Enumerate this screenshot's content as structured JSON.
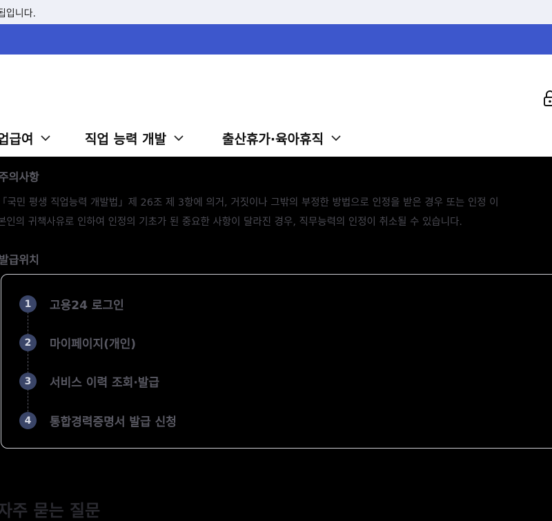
{
  "notice_bar": {
    "text": "됩입니다."
  },
  "header": {
    "nav": [
      {
        "label": "업급여"
      },
      {
        "label": "직업 능력 개발"
      },
      {
        "label": "출산휴가·육아휴직"
      }
    ],
    "icons": {
      "lock": "lock-icon",
      "chevron": "chevron-down-icon"
    }
  },
  "caution": {
    "title": "주의사항",
    "lines": [
      "「국민 평생 직업능력 개발법」제 26조 제 3항에 의거, 거짓이나 그밖의 부정한 방법으로 인정을 받은 경우 또는 인정 이",
      "본인의 귀책사유로 인하여 인정의 기초가 된 중요한 사항이 달라진 경우, 직무능력의 인정이 취소될 수 있습니다."
    ]
  },
  "issue": {
    "title": "발급위치",
    "steps": [
      {
        "num": "1",
        "label": "고용24 로그인"
      },
      {
        "num": "2",
        "label": "마이페이지(개인)"
      },
      {
        "num": "3",
        "label": "서비스 이력 조회·발급"
      },
      {
        "num": "4",
        "label": "통합경력증명서 발급 신청"
      }
    ]
  },
  "faq": {
    "title": "자주 묻는 질문"
  },
  "colors": {
    "blue_band": "#3d57cc",
    "step_badge": "#3a4568",
    "notice_bg": "#eef0f7"
  }
}
